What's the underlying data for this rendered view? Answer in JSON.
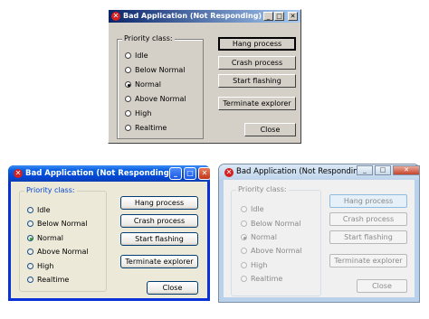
{
  "window_title": "Bad Application (Not Responding)",
  "title_icon": "error-icon",
  "caption_buttons": {
    "minimize": "_",
    "maximize": "□",
    "close": "✕"
  },
  "priority_group": {
    "label": "Priority class:",
    "options": [
      "Idle",
      "Below Normal",
      "Normal",
      "Above Normal",
      "High",
      "Realtime"
    ],
    "selected": "Normal"
  },
  "buttons": {
    "hang": "Hang process",
    "crash": "Crash process",
    "flash": "Start flashing",
    "terminate": "Terminate explorer",
    "close": "Close"
  },
  "colors": {
    "classic_face": "#d4d0c8",
    "classic_title": "#0a246a",
    "xp_title": "#0046d5",
    "xp_face": "#ece9d8",
    "vista_frame": "#b9d1ea",
    "vista_disabled_text": "#8a8a8a"
  }
}
